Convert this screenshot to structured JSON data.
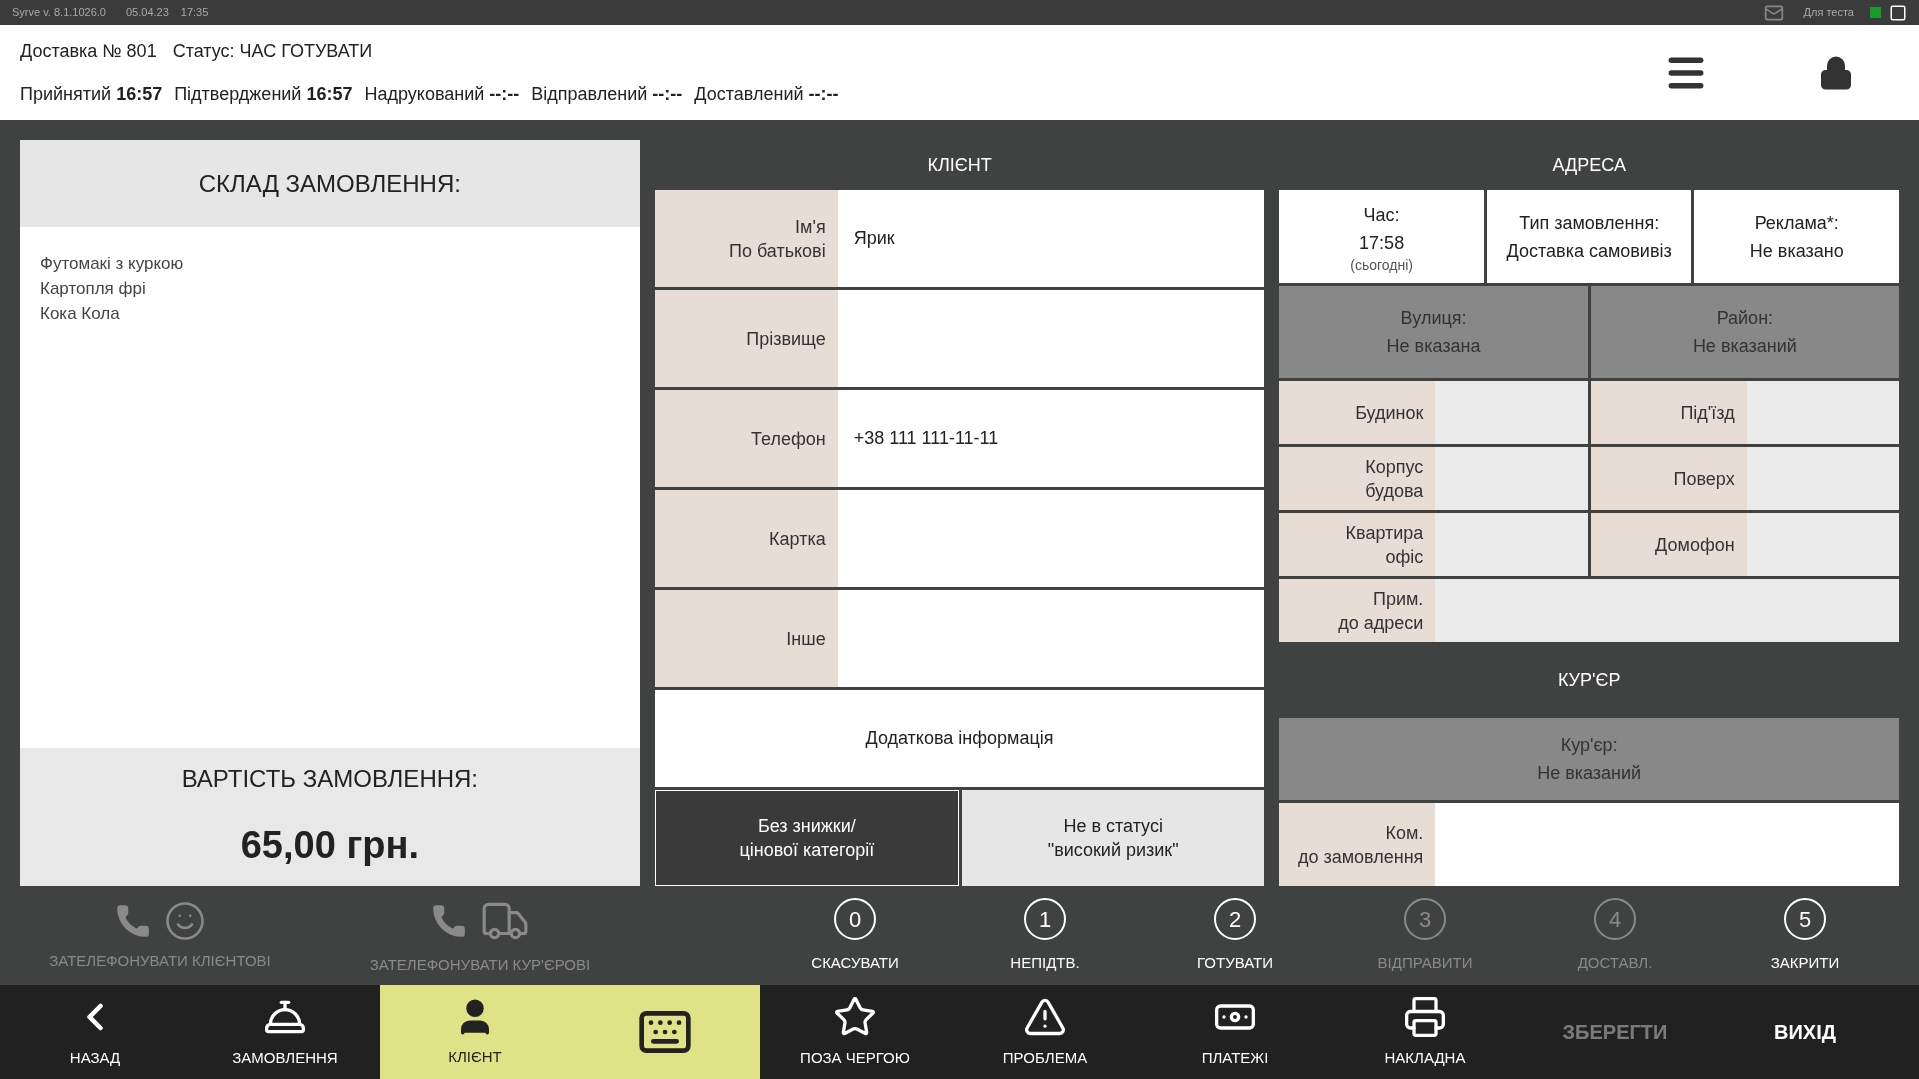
{
  "app_bar": {
    "version": "Syrve v. 8.1.1026.0",
    "date": "05.04.23",
    "time": "17:35",
    "mode": "Для теста",
    "online": true
  },
  "header": {
    "title": "Доставка № 801",
    "status_label": "Статус:",
    "status": "ЧАС ГОТУВАТИ",
    "timestamps": [
      {
        "label": "Прийнятий",
        "value": "16:57"
      },
      {
        "label": "Підтверджений",
        "value": "16:57"
      },
      {
        "label": "Надрукований",
        "value": "--:--"
      },
      {
        "label": "Відправлений",
        "value": "--:--"
      },
      {
        "label": "Доставлений",
        "value": "--:--"
      }
    ]
  },
  "order": {
    "title": "СКЛАД ЗАМОВЛЕННЯ:",
    "items": [
      "Футомакі з куркою",
      "Картопля фрі",
      "Кока Кола"
    ],
    "total_label": "ВАРТІСТЬ ЗАМОВЛЕННЯ:",
    "total": "65,00 грн."
  },
  "client": {
    "title": "КЛІЄНТ",
    "fields": [
      {
        "label": "Ім'я\nПо батькові",
        "value": "Ярик"
      },
      {
        "label": "Прізвище"
      },
      {
        "label": "Телефон",
        "value": "+38 111 111-11-11"
      },
      {
        "label": "Картка"
      },
      {
        "label": "Інше"
      }
    ],
    "extra_info": "Додаткова інформація",
    "toggles": [
      {
        "label": "Без знижки/\nцінової категорії",
        "selected": true
      },
      {
        "label": "Не в статусі\n\"високий ризик\"",
        "selected": false
      }
    ]
  },
  "address": {
    "title": "АДРЕСА",
    "summary": [
      {
        "label": "Час:",
        "value": "17:58",
        "note": "(сьогодні)"
      },
      {
        "label": "Тип замовлення:",
        "value": "Доставка самовивіз"
      },
      {
        "label": "Реклама*:",
        "value": "Не вказано"
      }
    ],
    "selectors": [
      {
        "label": "Вулиця:",
        "value": "Не вказана"
      },
      {
        "label": "Район:",
        "value": "Не вказаний"
      }
    ],
    "fields": [
      {
        "label": "Будинок"
      },
      {
        "label": "Під'їзд"
      },
      {
        "label": "Корпус\nбудова"
      },
      {
        "label": "Поверх"
      },
      {
        "label": "Квартира\nофіс"
      },
      {
        "label": "Домофон"
      }
    ],
    "note_field": {
      "label": "Прим.\nдо адреси"
    }
  },
  "courier": {
    "title": "КУР'ЄР",
    "selector": {
      "label": "Кур'єр:",
      "value": "Не вказаний"
    },
    "comment_field": {
      "label": "Ком.\nдо замовлення"
    }
  },
  "contact_actions": [
    {
      "kind": "client",
      "label": "ЗАТЕЛЕФОНУВАТИ КЛІЄНТОВІ",
      "disabled": true
    },
    {
      "kind": "courier",
      "label": "ЗАТЕЛЕФОНУВАТИ КУР'ЄРОВІ",
      "disabled": true
    }
  ],
  "status_steps": [
    {
      "number": "0",
      "label": "СКАСУВАТИ",
      "disabled": false
    },
    {
      "number": "1",
      "label": "НЕПІДТВ.",
      "disabled": false
    },
    {
      "number": "2",
      "label": "ГОТУВАТИ",
      "disabled": false
    },
    {
      "number": "3",
      "label": "ВІДПРАВИТИ",
      "disabled": true
    },
    {
      "number": "4",
      "label": "ДОСТАВЛ.",
      "disabled": true
    },
    {
      "number": "5",
      "label": "ЗАКРИТИ",
      "disabled": false
    }
  ],
  "nav": [
    {
      "kind": "back",
      "label": "НАЗАД",
      "selected": false,
      "disabled": false
    },
    {
      "kind": "order",
      "label": "ЗАМОВЛЕННЯ",
      "selected": false,
      "disabled": false
    },
    {
      "kind": "client",
      "label": "КЛІЄНТ",
      "selected": true,
      "disabled": false
    },
    {
      "kind": "keyboard",
      "selected": true,
      "disabled": false
    },
    {
      "kind": "priority",
      "label": "ПОЗА ЧЕРГОЮ",
      "selected": false,
      "disabled": false
    },
    {
      "kind": "problem",
      "label": "ПРОБЛЕМА",
      "selected": false,
      "disabled": false
    },
    {
      "kind": "payments",
      "label": "ПЛАТЕЖІ",
      "selected": false,
      "disabled": false
    },
    {
      "kind": "invoice",
      "label": "НАКЛАДНА",
      "selected": false,
      "disabled": false
    },
    {
      "kind": "text",
      "label": "ЗБЕРЕГТИ",
      "selected": false,
      "disabled": true
    },
    {
      "kind": "text",
      "label": "ВИХІД",
      "selected": false,
      "disabled": false
    }
  ]
}
